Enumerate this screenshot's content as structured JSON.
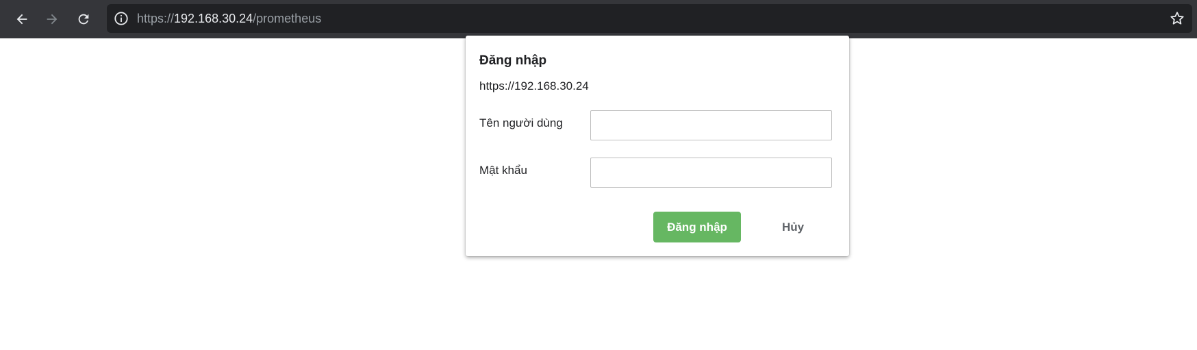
{
  "browser": {
    "url_scheme": "https://",
    "url_host": "192.168.30.24",
    "url_path": "/prometheus",
    "icons": {
      "back": "back-arrow-icon",
      "forward": "forward-arrow-icon",
      "reload": "reload-icon",
      "site_info": "info-icon",
      "bookmark": "star-icon"
    }
  },
  "dialog": {
    "title": "Đăng nhập",
    "origin": "https://192.168.30.24",
    "username_label": "Tên người dùng",
    "username_value": "",
    "password_label": "Mật khẩu",
    "password_value": "",
    "submit_label": "Đăng nhập",
    "cancel_label": "Hủy"
  },
  "colors": {
    "toolbar_bg": "#35363a",
    "omnibox_bg": "#202124",
    "submit_button": "#66b762"
  }
}
